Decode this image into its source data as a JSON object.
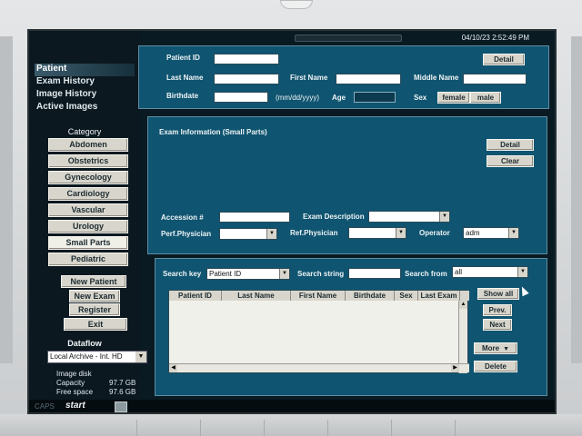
{
  "datetime": "04/10/23 2:52:49 PM",
  "nav": [
    "Patient",
    "Exam History",
    "Image History",
    "Active Images"
  ],
  "category": {
    "title": "Category",
    "items": [
      "Abdomen",
      "Obstetrics",
      "Gynecology",
      "Cardiology",
      "Vascular",
      "Urology",
      "Small Parts",
      "Pediatric"
    ],
    "selected": "Small Parts"
  },
  "actions": [
    "New Patient",
    "New Exam",
    "Register",
    "Exit"
  ],
  "dataflow": {
    "title": "Dataflow",
    "value": "Local Archive - Int. HD"
  },
  "disk": {
    "title": "Image disk",
    "capacity_label": "Capacity",
    "capacity": "97.7 GB",
    "free_label": "Free space",
    "free": "97.6 GB"
  },
  "taskbar": {
    "caps": "CAPS",
    "start": "start"
  },
  "patient": {
    "patient_id_label": "Patient ID",
    "patient_id": "",
    "detail_button": "Detail",
    "last_name_label": "Last Name",
    "last_name": "",
    "first_name_label": "First Name",
    "first_name": "",
    "middle_name_label": "Middle Name",
    "middle_name": "",
    "birthdate_label": "Birthdate",
    "birthdate": "",
    "date_format": "(mm/dd/yyyy)",
    "age_label": "Age",
    "age": "",
    "sex_label": "Sex",
    "sex_options": [
      "female",
      "male"
    ]
  },
  "exam": {
    "title": "Exam Information (Small Parts)",
    "detail_button": "Detail",
    "clear_button": "Clear",
    "accession_label": "Accession #",
    "accession": "",
    "exam_desc_label": "Exam Description",
    "exam_desc": "",
    "perf_physician_label": "Perf.Physician",
    "perf_physician": "",
    "ref_physician_label": "Ref.Physician",
    "ref_physician": "",
    "operator_label": "Operator",
    "operator": "adm"
  },
  "search": {
    "key_label": "Search key",
    "key": "Patient ID",
    "string_label": "Search string",
    "string": "",
    "from_label": "Search from",
    "from": "all",
    "columns": [
      "Patient ID",
      "Last Name",
      "First Name",
      "Birthdate",
      "Sex",
      "Last Exam"
    ],
    "show_all_button": "Show all",
    "prev_button": "Prev.",
    "next_button": "Next",
    "more_button": "More",
    "delete_button": "Delete"
  },
  "colors": {
    "panel": "#0f5470",
    "screen": "#0a1a22",
    "button": "#d8d6cc"
  }
}
